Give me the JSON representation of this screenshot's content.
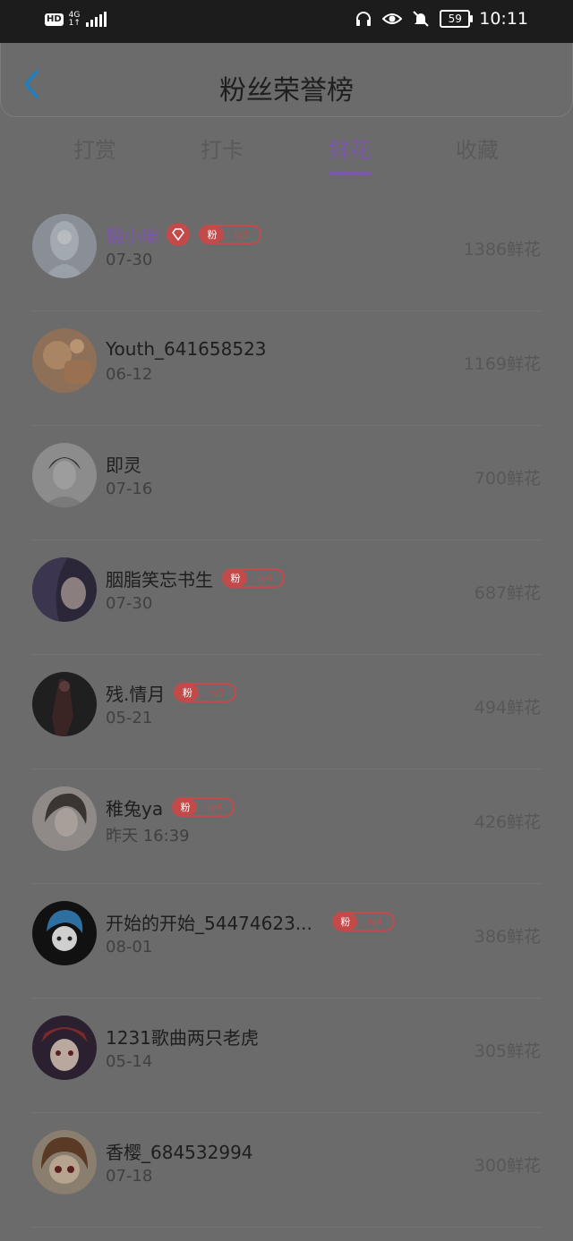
{
  "status_bar": {
    "hd": "HD",
    "network_top": "4G",
    "network_bottom": "1↑",
    "battery": "59",
    "time": "10:11",
    "icons": [
      "headphones-icon",
      "eye-icon",
      "bell-muted-icon"
    ]
  },
  "header": {
    "back_icon": "chevron-left-icon",
    "title": "粉丝荣誉榜"
  },
  "tabs": [
    {
      "label": "打赏",
      "active": false
    },
    {
      "label": "打卡",
      "active": false
    },
    {
      "label": "鲜花",
      "active": true
    },
    {
      "label": "收藏",
      "active": false
    }
  ],
  "colors": {
    "accent": "#7b59a7",
    "badge": "#c44a4a"
  },
  "fan_badge_label": "粉",
  "rows": [
    {
      "name": "糯小喵",
      "date": "07-30",
      "score": "1386鲜花",
      "vip": true,
      "level": "lv2"
    },
    {
      "name": "Youth_641658523",
      "date": "06-12",
      "score": "1169鲜花",
      "vip": false,
      "level": ""
    },
    {
      "name": "即灵",
      "date": "07-16",
      "score": "700鲜花",
      "vip": false,
      "level": ""
    },
    {
      "name": "胭脂笑忘书生",
      "date": "07-30",
      "score": "687鲜花",
      "vip": false,
      "level": "lv4"
    },
    {
      "name": "残.情月",
      "date": "05-21",
      "score": "494鲜花",
      "vip": false,
      "level": "lv3"
    },
    {
      "name": "稚兔ya",
      "date": "昨天 16:39",
      "score": "426鲜花",
      "vip": false,
      "level": "lv4"
    },
    {
      "name": "开始的开始_54474623...",
      "date": "08-01",
      "score": "386鲜花",
      "vip": false,
      "level": "lv4"
    },
    {
      "name": "1231歌曲两只老虎",
      "date": "05-14",
      "score": "305鲜花",
      "vip": false,
      "level": ""
    },
    {
      "name": "香樱_684532994",
      "date": "07-18",
      "score": "300鲜花",
      "vip": false,
      "level": ""
    }
  ]
}
